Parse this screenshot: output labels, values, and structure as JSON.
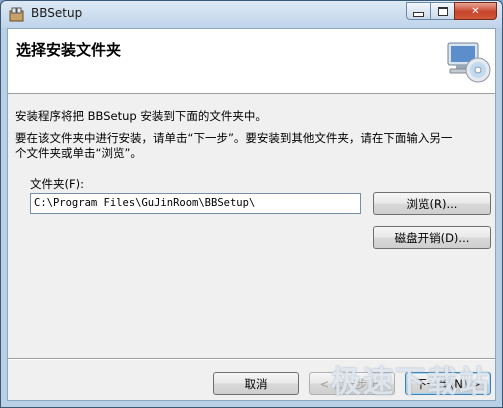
{
  "window": {
    "title": "BBSetup",
    "minimize_label": "▭",
    "maximize_label": "▣",
    "close_label": "✕"
  },
  "banner": {
    "title": "选择安装文件夹",
    "icon": "computer-cd-icon"
  },
  "body": {
    "line1": "安装程序将把 BBSetup 安装到下面的文件夹中。",
    "line2": "要在该文件夹中进行安装，请单击“下一步”。要安装到其他文件夹，请在下面输入另一",
    "line3": "个文件夹或单击“浏览”。"
  },
  "folder": {
    "label": "文件夹(F):",
    "path": "C:\\Program Files\\GuJinRoom\\BBSetup\\"
  },
  "buttons": {
    "browse": "浏览(R)...",
    "disk_cost": "磁盘开销(D)...",
    "cancel": "取消",
    "prev": "< 上一步(B)",
    "next": "下一步(N) >"
  },
  "watermark": "极速下载站"
}
